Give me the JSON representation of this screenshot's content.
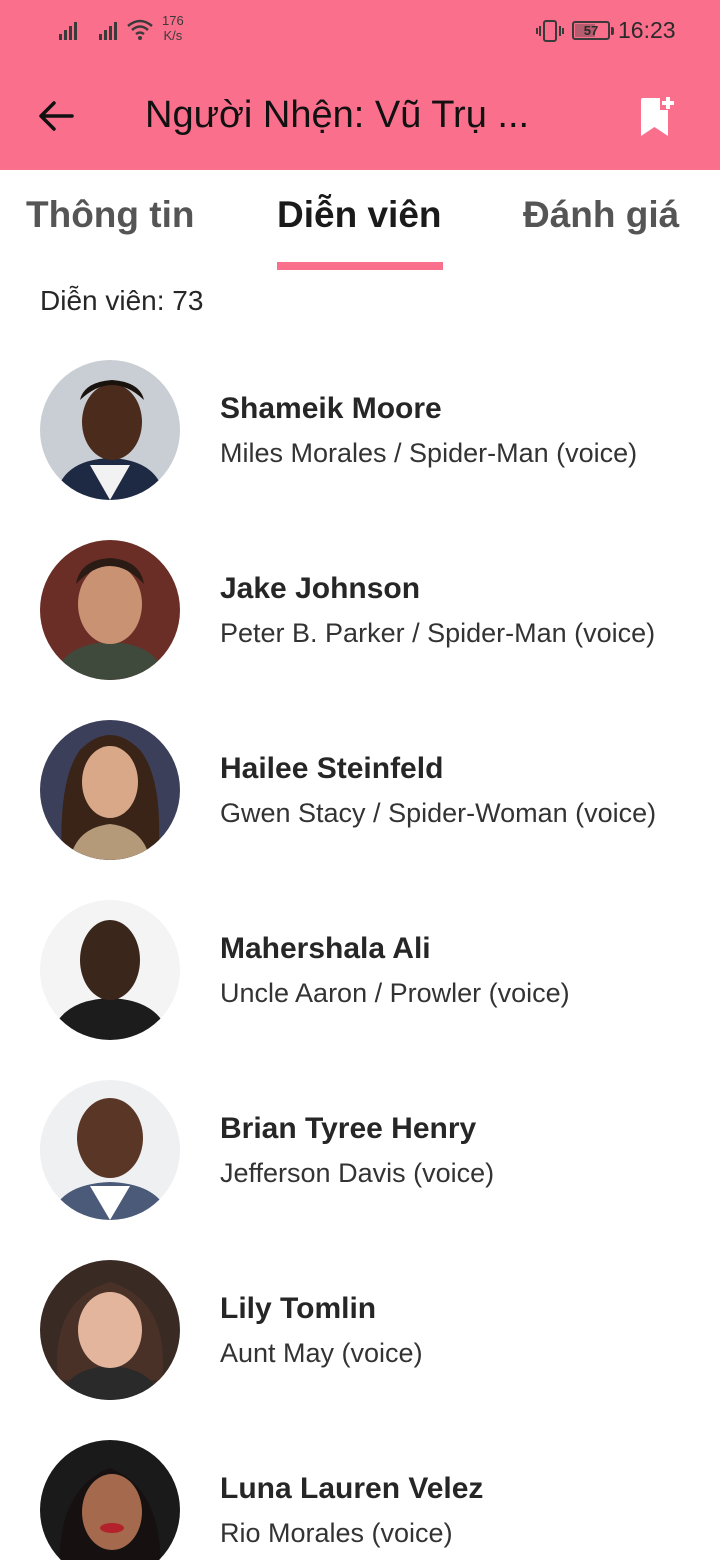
{
  "status_bar": {
    "net_speed_value": "176",
    "net_speed_unit": "K/s",
    "battery": "57",
    "time": "16:23"
  },
  "header": {
    "title": "Người Nhện: Vũ Trụ ...",
    "back_icon": "arrow-left-icon",
    "bookmark_icon": "bookmark-add-icon",
    "background_color": "#f96f8c"
  },
  "tabs": [
    {
      "label": "Thông tin",
      "active": false
    },
    {
      "label": "Diễn viên",
      "active": true
    },
    {
      "label": "Đánh giá",
      "active": false
    }
  ],
  "cast_count": "Diễn viên: 73",
  "cast": [
    {
      "name": "Shameik Moore",
      "role": "Miles Morales / Spider-Man (voice)"
    },
    {
      "name": "Jake Johnson",
      "role": "Peter B. Parker / Spider-Man (voice)"
    },
    {
      "name": "Hailee Steinfeld",
      "role": "Gwen Stacy / Spider-Woman (voice)"
    },
    {
      "name": "Mahershala Ali",
      "role": "Uncle Aaron / Prowler (voice)"
    },
    {
      "name": "Brian Tyree Henry",
      "role": "Jefferson Davis (voice)"
    },
    {
      "name": "Lily Tomlin",
      "role": "Aunt May (voice)"
    },
    {
      "name": "Luna Lauren Velez",
      "role": "Rio Morales (voice)"
    }
  ]
}
